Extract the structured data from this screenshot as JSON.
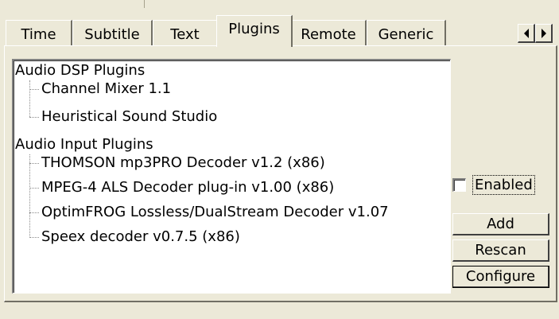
{
  "tabs": [
    {
      "label": "Time"
    },
    {
      "label": "Subtitle"
    },
    {
      "label": "Text"
    },
    {
      "label": "Plugins",
      "active": true
    },
    {
      "label": "Remote"
    },
    {
      "label": "Generic"
    }
  ],
  "tree": {
    "groups": [
      {
        "label": "Audio DSP Plugins",
        "children": [
          "Channel Mixer 1.1",
          "Heuristical Sound Studio"
        ]
      },
      {
        "label": "Audio Input Plugins",
        "children": [
          "THOMSON mp3PRO Decoder v1.2 (x86)",
          "MPEG-4 ALS Decoder plug-in v1.00 (x86)",
          "OptimFROG Lossless/DualStream Decoder v1.07",
          "Speex decoder v0.7.5 (x86)"
        ]
      }
    ]
  },
  "controls": {
    "enabled_label": "Enabled",
    "enabled_checked": false,
    "add_label": "Add",
    "rescan_label": "Rescan",
    "configure_label": "Configure"
  },
  "icons": {
    "scroll_left": "triangle-left",
    "scroll_right": "triangle-right"
  }
}
